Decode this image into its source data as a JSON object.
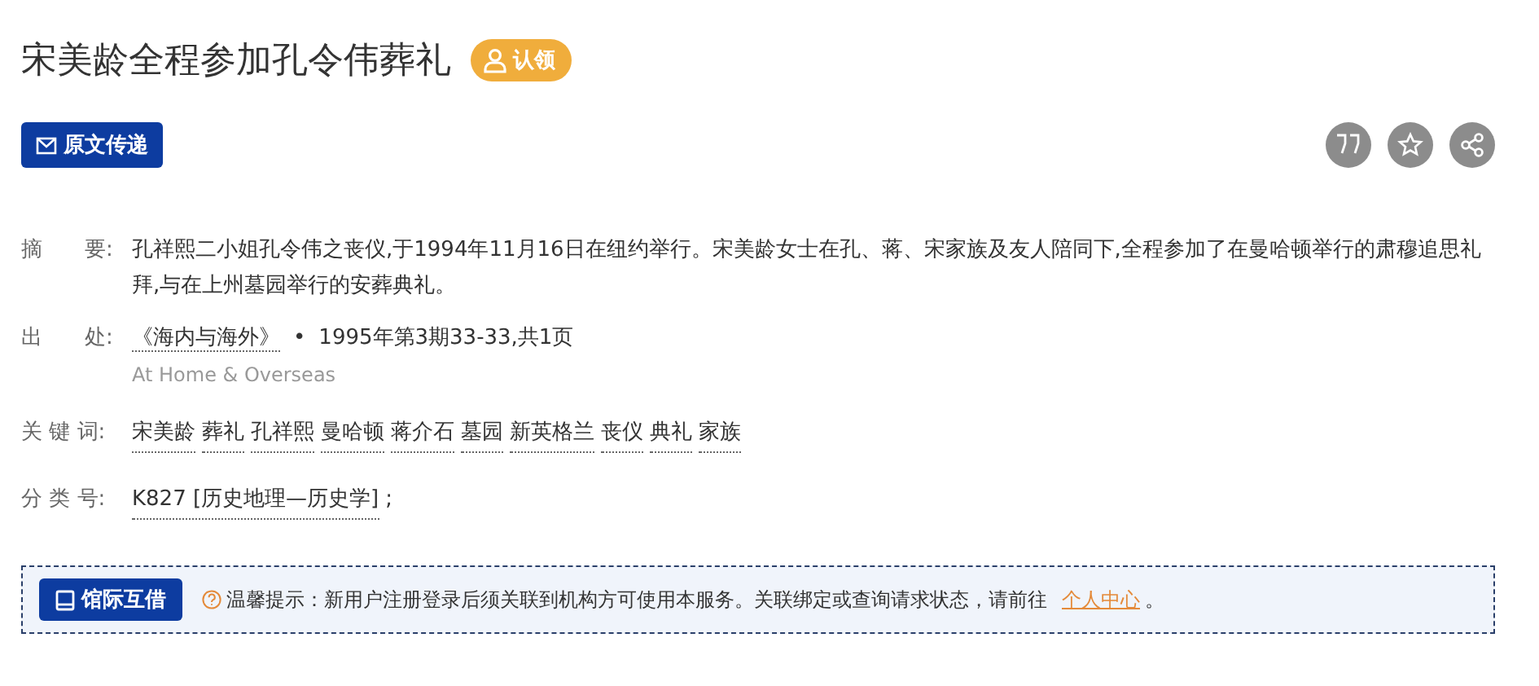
{
  "title": "宋美龄全程参加孔令伟葬礼",
  "claim_button": "认领",
  "delivery_button": "原文传递",
  "fields": [
    {
      "kind": "text",
      "label": "摘　　要:",
      "text": "孔祥熙二小姐孔令伟之丧仪,于1994年11月16日在纽约举行。宋美龄女士在孔、蒋、宋家族及友人陪同下,全程参加了在曼哈顿举行的肃穆追思礼拜,与在上州墓园举行的安葬典礼。"
    },
    {
      "kind": "source",
      "label": "出　　处:",
      "journal": "《海内与海外》",
      "separator": "•",
      "issue": "1995年第3期33-33,共1页",
      "english": "At Home & Overseas"
    },
    {
      "kind": "links",
      "label": "关 键 词:",
      "links": [
        "宋美龄",
        "葬礼",
        "孔祥熙",
        "曼哈顿",
        "蒋介石",
        "墓园",
        "新英格兰",
        "丧仪",
        "典礼",
        "家族"
      ]
    },
    {
      "kind": "links",
      "label": "分 类 号:",
      "links": [
        "K827 [历史地理—历史学]"
      ],
      "suffix": ";"
    }
  ],
  "notice": {
    "button": "馆际互借",
    "text": "温馨提示：新用户注册登录后须关联到机构方可使用本服务。关联绑定或查询请求状态，请前往",
    "link": "个人中心",
    "end": "。"
  }
}
